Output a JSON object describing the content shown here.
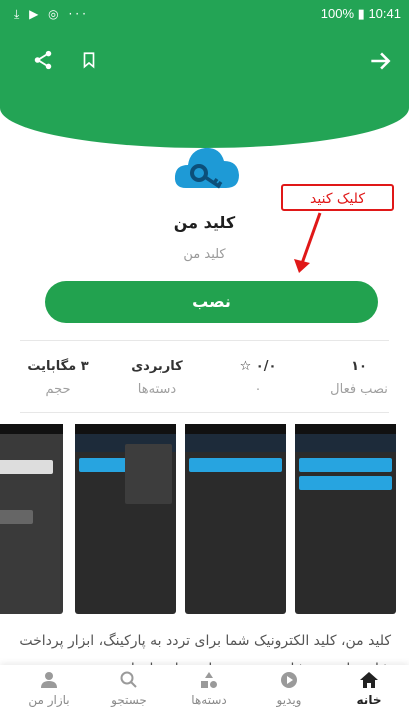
{
  "status_bar": {
    "left_icons": "⤓ ▶ ◎ ···",
    "time": "10:41",
    "battery": "100%"
  },
  "app": {
    "title": "کلید من",
    "subtitle": "کلید من",
    "install_label": "نصب"
  },
  "callout": {
    "text": "کلیک کنید"
  },
  "stats": [
    {
      "value": "۱۰",
      "label": "نصب فعال"
    },
    {
      "value": "۰/۰ ☆",
      "label": "۰"
    },
    {
      "value": "کاربردی",
      "label": "دسته‌ها"
    },
    {
      "value": "۳ مگابایت",
      "label": "حجم"
    }
  ],
  "description": "کلید من، کلید الکترونیک شما برای تردد به پارکینگ، ابزار پرداخت شارژ واحد و مشاهده صورتحساب ساختمان است.",
  "bottom_nav": [
    {
      "label": "خانه",
      "icon": "home-icon"
    },
    {
      "label": "ویدیو",
      "icon": "video-icon"
    },
    {
      "label": "دسته‌ها",
      "icon": "categories-icon"
    },
    {
      "label": "جستجو",
      "icon": "search-icon"
    },
    {
      "label": "بازار من",
      "icon": "profile-icon"
    }
  ],
  "colors": {
    "primary": "#23a455",
    "callout": "#e01818",
    "screenshot_accent": "#27a4e0"
  }
}
